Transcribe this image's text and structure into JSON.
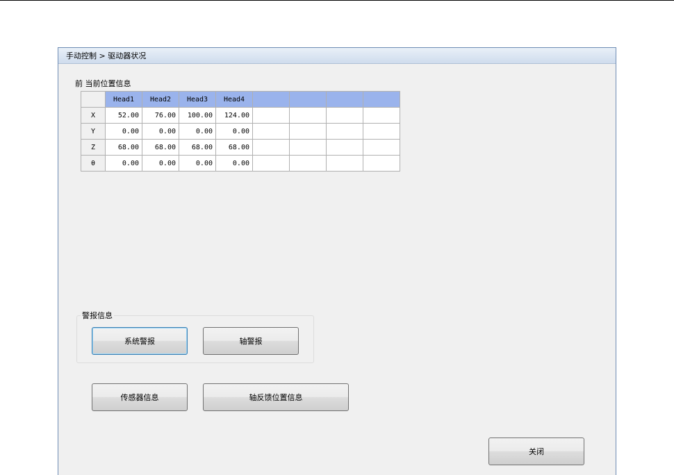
{
  "window": {
    "breadcrumb": "手动控制 > 驱动器状况"
  },
  "position_section": {
    "label": "前 当前位置信息",
    "columns": [
      "Head1",
      "Head2",
      "Head3",
      "Head4",
      "",
      "",
      "",
      ""
    ],
    "rows": [
      {
        "axis": "X",
        "values": [
          "52.00",
          "76.00",
          "100.00",
          "124.00",
          "",
          "",
          "",
          ""
        ]
      },
      {
        "axis": "Y",
        "values": [
          "0.00",
          "0.00",
          "0.00",
          "0.00",
          "",
          "",
          "",
          ""
        ]
      },
      {
        "axis": "Z",
        "values": [
          "68.00",
          "68.00",
          "68.00",
          "68.00",
          "",
          "",
          "",
          ""
        ]
      },
      {
        "axis": "θ",
        "values": [
          "0.00",
          "0.00",
          "0.00",
          "0.00",
          "",
          "",
          "",
          ""
        ]
      }
    ]
  },
  "alarm_section": {
    "label": "警报信息",
    "system_alarm_button": "系统警报",
    "axis_alarm_button": "轴警报"
  },
  "info_buttons": {
    "sensor_info": "传感器信息",
    "axis_feedback_position": "轴反馈位置信息"
  },
  "close_button": "关闭",
  "colors": {
    "header_fill": "#9ab3ec",
    "window_background": "#f0f0f0",
    "titlebar_gradient_top": "#e9f0f8"
  }
}
